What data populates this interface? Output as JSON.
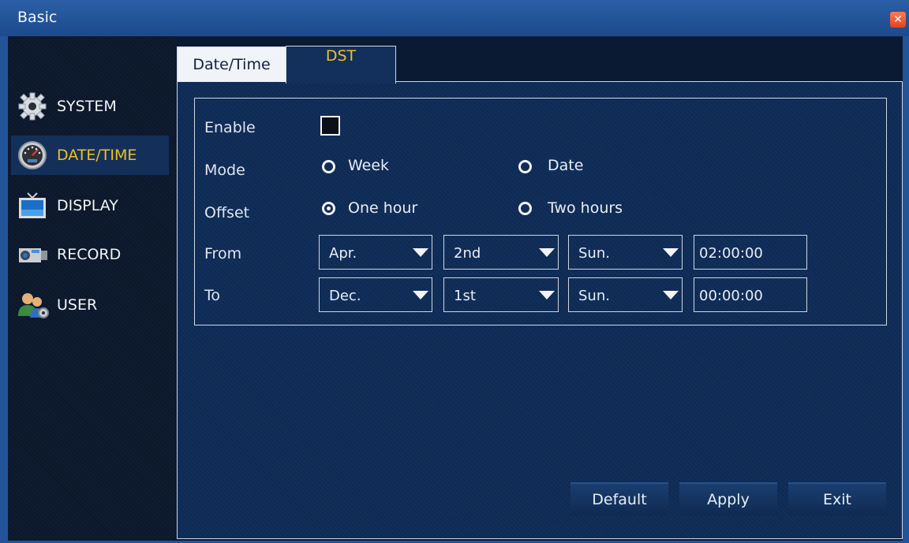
{
  "window": {
    "title": "Basic",
    "close_icon": "close-icon"
  },
  "tabs": [
    {
      "label": "Date/Time",
      "active": false
    },
    {
      "label": "DST",
      "active": true
    }
  ],
  "sidebar": {
    "items": [
      {
        "label": "SYSTEM",
        "icon": "gear-icon",
        "active": false
      },
      {
        "label": "DATE/TIME",
        "icon": "gauge-icon",
        "active": true
      },
      {
        "label": "DISPLAY",
        "icon": "tv-icon",
        "active": false
      },
      {
        "label": "RECORD",
        "icon": "camera-icon",
        "active": false
      },
      {
        "label": "USER",
        "icon": "users-icon",
        "active": false
      }
    ]
  },
  "form": {
    "enable_label": "Enable",
    "enable_checked": false,
    "mode_label": "Mode",
    "mode_options": [
      "Week",
      "Date"
    ],
    "mode_selected": null,
    "offset_label": "Offset",
    "offset_options": [
      "One hour",
      "Two hours"
    ],
    "offset_selected": "One hour",
    "from_label": "From",
    "to_label": "To",
    "from": {
      "month": "Apr.",
      "week": "2nd",
      "day": "Sun.",
      "time": "02:00:00"
    },
    "to": {
      "month": "Dec.",
      "week": "1st",
      "day": "Sun.",
      "time": "00:00:00"
    }
  },
  "buttons": {
    "default": "Default",
    "apply": "Apply",
    "exit": "Exit"
  },
  "colors": {
    "accent": "#f0c020",
    "titlebar": "#2b5fa6",
    "panel": "#12305c"
  }
}
